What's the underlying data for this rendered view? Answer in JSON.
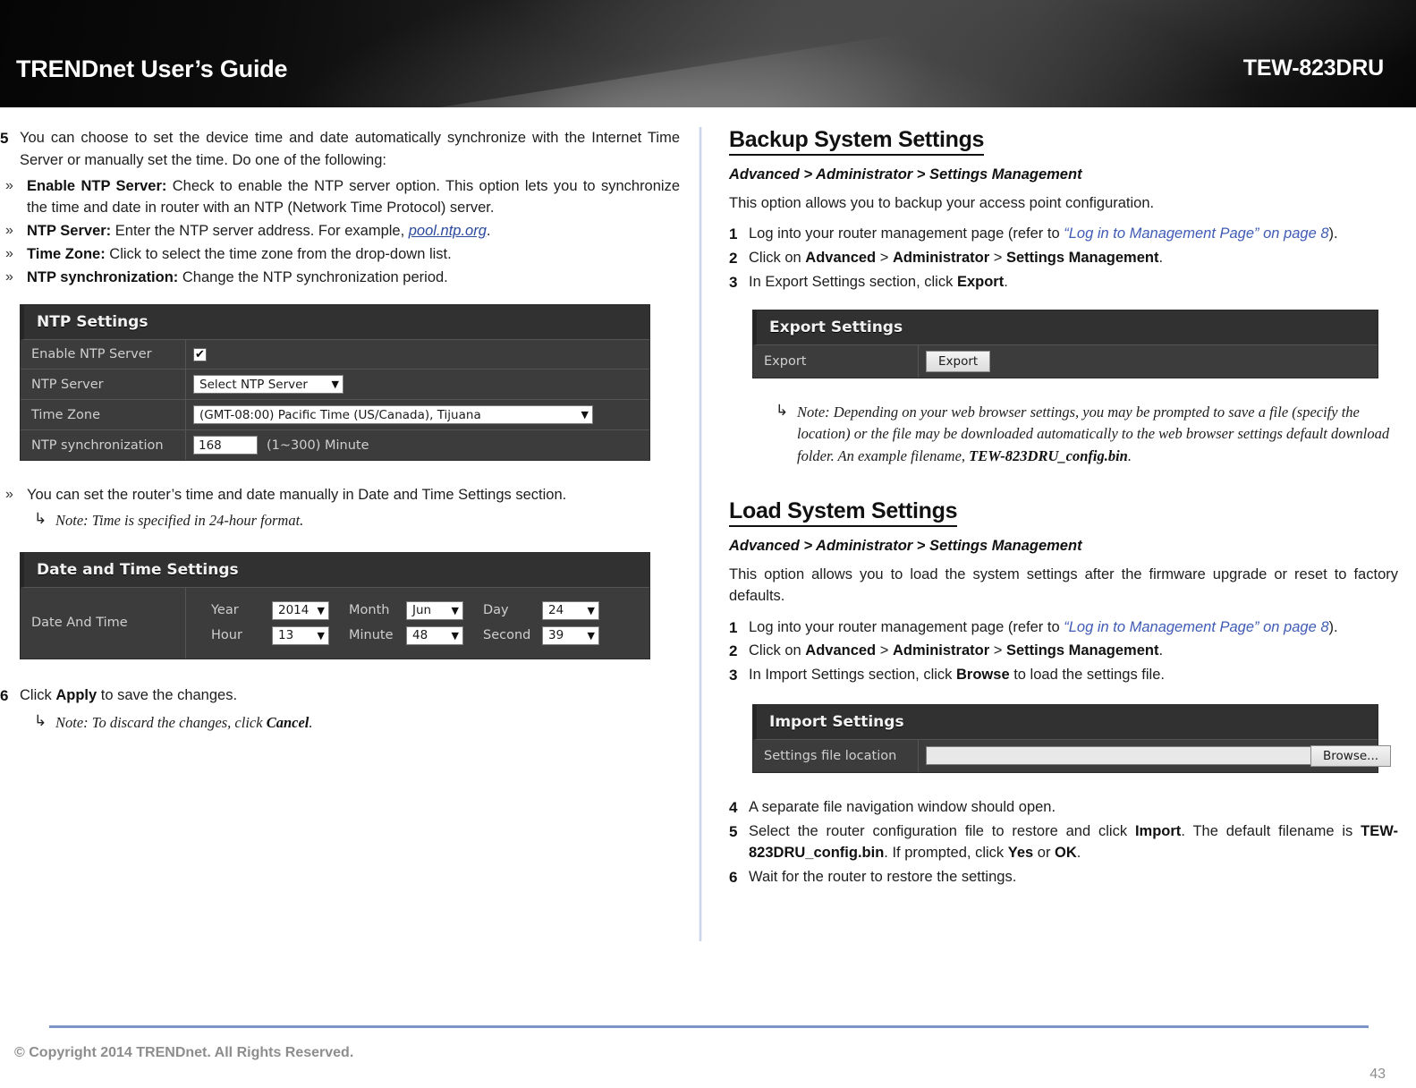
{
  "header": {
    "title": "TRENDnet User’s Guide",
    "model": "TEW-823DRU"
  },
  "left_column": {
    "step5": {
      "num": "5",
      "text_part1": "You can choose to set the device time and date automatically synchronize with the Internet Time Server or manually set the time. Do one of the following:"
    },
    "bullets": [
      {
        "marker": "»",
        "label": "Enable NTP Server:",
        "text": " Check to enable the NTP server option. This option lets you to synchronize the time and date in router with an NTP (Network Time Protocol) server."
      },
      {
        "marker": "»",
        "label": "NTP Server:",
        "text": " Enter the NTP server address. For example, ",
        "link": "pool.ntp.org",
        "text_after": "."
      },
      {
        "marker": "»",
        "label": "Time Zone:",
        "text": " Click to select the time zone from the drop-down list."
      },
      {
        "marker": "»",
        "label": "NTP synchronization:",
        "text": " Change the NTP synchronization period."
      }
    ],
    "ntp_panel": {
      "title": "NTP Settings",
      "rows": [
        {
          "label": "Enable NTP Server",
          "control": "checkbox",
          "checked": "✔"
        },
        {
          "label": "NTP Server",
          "control": "select",
          "value": "Select NTP Server"
        },
        {
          "label": "Time Zone",
          "control": "select",
          "value": "(GMT-08:00) Pacific Time (US/Canada), Tijuana"
        },
        {
          "label": "NTP synchronization",
          "control": "input",
          "value": "168",
          "suffix": "(1~300) Minute"
        }
      ]
    },
    "manual_bullet": {
      "marker": "»",
      "text": "You can set the router’s time and date manually in Date and Time Settings section."
    },
    "note_24h": "Note: Time is specified in 24-hour format.",
    "datetime_panel": {
      "title": "Date and Time Settings",
      "row_label": "Date And Time",
      "fields": [
        {
          "caption": "Year",
          "value": "2014"
        },
        {
          "caption": "Month",
          "value": "Jun"
        },
        {
          "caption": "Day",
          "value": "24"
        },
        {
          "caption": "Hour",
          "value": "13"
        },
        {
          "caption": "Minute",
          "value": "48"
        },
        {
          "caption": "Second",
          "value": "39"
        }
      ]
    },
    "step6": {
      "num": "6",
      "pre": "Click ",
      "bold": "Apply",
      "post": " to save the changes."
    },
    "note_cancel_pre": "Note: To discard the changes, click ",
    "note_cancel_bold": "Cancel",
    "note_cancel_post": "."
  },
  "right_column": {
    "backup": {
      "heading": "Backup System Settings",
      "breadcrumb": "Advanced > Administrator > Settings Management",
      "intro": "This option allows you to backup your access point configuration.",
      "steps": [
        {
          "num": "1",
          "pre": "Log into your router management page (refer to ",
          "xref": "“Log in to Management Page” on page 8",
          "post": ")."
        },
        {
          "num": "2",
          "pre": "Click on ",
          "b1": "Advanced",
          "mid1": " > ",
          "b2": "Administrator",
          "mid2": " > ",
          "b3": "Settings Management",
          "post": "."
        },
        {
          "num": "3",
          "pre": "In Export Settings section, click ",
          "b1": "Export",
          "post": "."
        }
      ],
      "export_panel": {
        "title": "Export Settings",
        "row_label": "Export",
        "button": "Export"
      },
      "note": {
        "part1": "Note: Depending on your web browser settings, you may be prompted to save a file  (specify the location) or the file may be downloaded automatically to the web browser settings default download folder. An example filename, ",
        "bold": "TEW-823DRU_config.bin",
        "part2": "."
      }
    },
    "load": {
      "heading": "Load System Settings",
      "breadcrumb": "Advanced > Administrator > Settings Management",
      "intro": "This option allows you to load the system settings after the firmware upgrade or reset to factory defaults.",
      "steps": [
        {
          "num": "1",
          "pre": "Log into your router management page (refer to ",
          "xref": "“Log in to Management Page” on page 8",
          "post": ")."
        },
        {
          "num": "2",
          "pre": "Click on ",
          "b1": "Advanced",
          "mid1": " > ",
          "b2": "Administrator",
          "mid2": " > ",
          "b3": "Settings Management",
          "post": "."
        },
        {
          "num": "3",
          "pre": "In Import Settings section, click ",
          "b1": "Browse",
          "post": " to load the settings file."
        }
      ],
      "import_panel": {
        "title": "Import Settings",
        "row_label": "Settings file location",
        "input_value": "",
        "button": "Browse..."
      },
      "steps_after": [
        {
          "num": "4",
          "text": "A separate file navigation window should open."
        },
        {
          "num": "5",
          "pre": "Select the router configuration file to restore and click ",
          "b1": "Import",
          "mid": ". The default filename is ",
          "b2": "TEW-823DRU_config.bin",
          "mid2": ". If prompted, click ",
          "b3": "Yes",
          "mid3": " or ",
          "b4": "OK",
          "post": "."
        },
        {
          "num": "6",
          "text": "Wait for the router to restore the settings."
        }
      ]
    }
  },
  "footer": {
    "copyright": "© Copyright 2014 TRENDnet. All Rights Reserved.",
    "page_number": "43"
  }
}
